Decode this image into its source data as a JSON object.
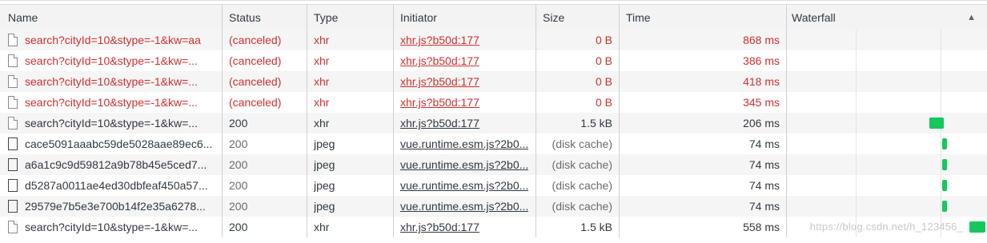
{
  "columns": {
    "name": "Name",
    "status": "Status",
    "type": "Type",
    "initiator": "Initiator",
    "size": "Size",
    "time": "Time",
    "waterfall": "Waterfall"
  },
  "sort_icon": "▲",
  "rows": [
    {
      "name": "search?cityId=10&stype=-1&kw=aa",
      "status": "(canceled)",
      "type": "xhr",
      "initiator": "xhr.js?b50d:177",
      "size": "0 B",
      "time": "868 ms",
      "icon": "file-icon",
      "state": "canceled"
    },
    {
      "name": "search?cityId=10&stype=-1&kw=...",
      "status": "(canceled)",
      "type": "xhr",
      "initiator": "xhr.js?b50d:177",
      "size": "0 B",
      "time": "386 ms",
      "icon": "file-icon",
      "state": "canceled"
    },
    {
      "name": "search?cityId=10&stype=-1&kw=...",
      "status": "(canceled)",
      "type": "xhr",
      "initiator": "xhr.js?b50d:177",
      "size": "0 B",
      "time": "418 ms",
      "icon": "file-icon",
      "state": "canceled"
    },
    {
      "name": "search?cityId=10&stype=-1&kw=...",
      "status": "(canceled)",
      "type": "xhr",
      "initiator": "xhr.js?b50d:177",
      "size": "0 B",
      "time": "345 ms",
      "icon": "file-icon",
      "state": "canceled"
    },
    {
      "name": "search?cityId=10&stype=-1&kw=...",
      "status": "200",
      "type": "xhr",
      "initiator": "xhr.js?b50d:177",
      "size": "1.5 kB",
      "time": "206 ms",
      "icon": "file-icon",
      "state": "ok"
    },
    {
      "name": "cace5091aaabc59de5028aae89ec6...",
      "status": "200",
      "type": "jpeg",
      "initiator": "vue.runtime.esm.js?2b0...",
      "size": "(disk cache)",
      "time": "74 ms",
      "icon": "image-thumbnail-icon",
      "state": "cached"
    },
    {
      "name": "a6a1c9c9d59812a9b78b45e5ced7...",
      "status": "200",
      "type": "jpeg",
      "initiator": "vue.runtime.esm.js?2b0...",
      "size": "(disk cache)",
      "time": "74 ms",
      "icon": "image-thumbnail-icon",
      "state": "cached"
    },
    {
      "name": "d5287a0011ae4ed30dbfeaf450a57...",
      "status": "200",
      "type": "jpeg",
      "initiator": "vue.runtime.esm.js?2b0...",
      "size": "(disk cache)",
      "time": "74 ms",
      "icon": "image-thumbnail-icon",
      "state": "cached"
    },
    {
      "name": "29579e7b5e3e700b14f2e35a6278...",
      "status": "200",
      "type": "jpeg",
      "initiator": "vue.runtime.esm.js?2b0...",
      "size": "(disk cache)",
      "time": "74 ms",
      "icon": "image-thumbnail-icon",
      "state": "cached"
    },
    {
      "name": "search?cityId=10&stype=-1&kw=...",
      "status": "200",
      "type": "xhr",
      "initiator": "xhr.js?b50d:177",
      "size": "1.5 kB",
      "time": "558 ms",
      "icon": "file-icon",
      "state": "ok"
    }
  ],
  "colors": {
    "canceled_text": "#d32f2f",
    "waterfall_bar": "#16c75d",
    "header_bg": "#f3f3f3",
    "stripe_bg": "#f5f5f5"
  },
  "watermark": "https://blog.csdn.net/h_123456_"
}
